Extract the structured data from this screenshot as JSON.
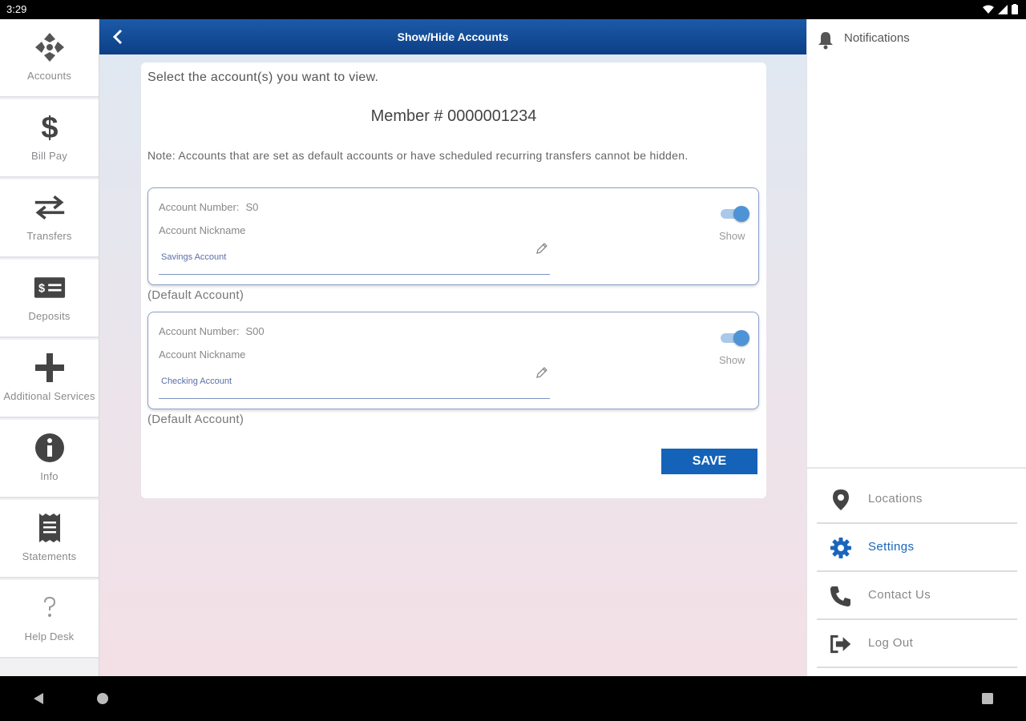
{
  "status_bar": {
    "time": "3:29"
  },
  "sidebar": {
    "items": [
      {
        "label": "Accounts",
        "icon": "accounts-icon"
      },
      {
        "label": "Bill Pay",
        "icon": "dollar-icon"
      },
      {
        "label": "Transfers",
        "icon": "transfer-arrows-icon"
      },
      {
        "label": "Deposits",
        "icon": "check-deposit-icon"
      },
      {
        "label": "Additional Services",
        "icon": "plus-icon"
      },
      {
        "label": "Info",
        "icon": "info-icon"
      },
      {
        "label": "Statements",
        "icon": "receipt-icon"
      },
      {
        "label": "Help Desk",
        "icon": "help-icon"
      }
    ]
  },
  "header": {
    "title": "Show/Hide Accounts"
  },
  "content": {
    "instruction": "Select the account(s) you want to view.",
    "member": "Member # 0000001234",
    "note": "Note: Accounts that are set as default accounts or have scheduled recurring transfers cannot be hidden.",
    "accounts": [
      {
        "number_label": "Account Number:",
        "number": "S0",
        "nickname_label": "Account Nickname",
        "nickname": "Savings Account",
        "toggle_label": "Show",
        "shown": true,
        "footer": "(Default Account)"
      },
      {
        "number_label": "Account Number:",
        "number": "S00",
        "nickname_label": "Account Nickname",
        "nickname": "Checking Account",
        "toggle_label": "Show",
        "shown": true,
        "footer": "(Default Account)"
      }
    ],
    "save_label": "SAVE"
  },
  "right_panel": {
    "notifications_label": "Notifications",
    "menu": [
      {
        "label": "Locations",
        "icon": "location-pin-icon",
        "active": false
      },
      {
        "label": "Settings",
        "icon": "gear-icon",
        "active": true
      },
      {
        "label": "Contact Us",
        "icon": "phone-icon",
        "active": false
      },
      {
        "label": "Log Out",
        "icon": "logout-icon",
        "active": false
      }
    ]
  },
  "colors": {
    "primary": "#1463b8",
    "header": "#0d3f86",
    "toggle": "#4e93d6"
  }
}
